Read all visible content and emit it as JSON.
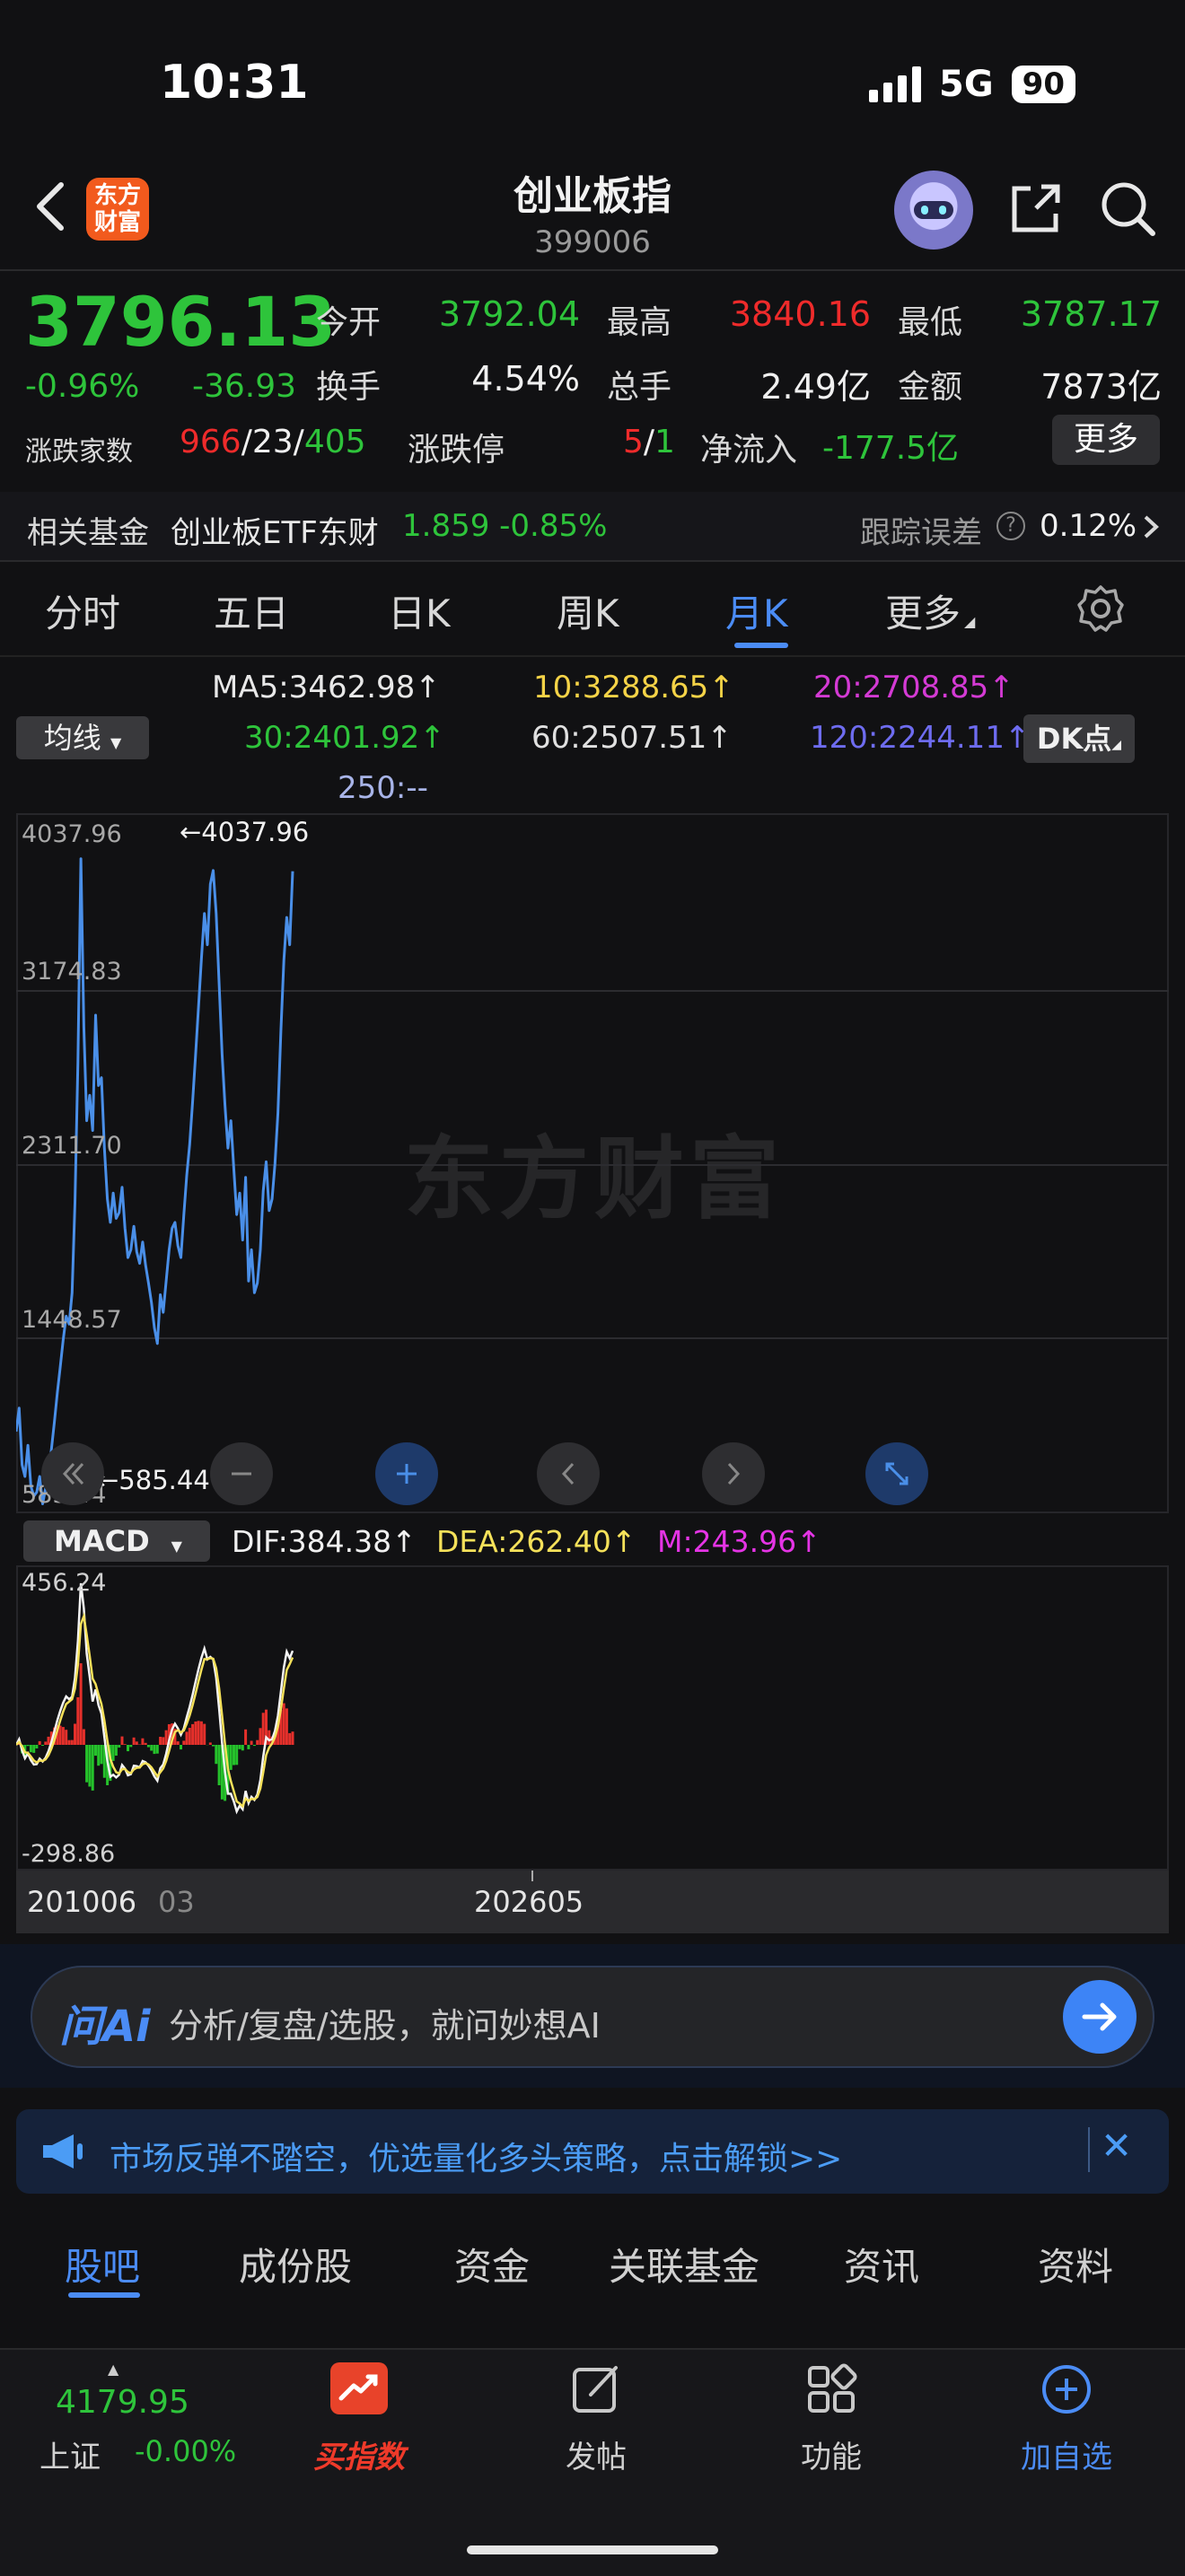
{
  "status": {
    "time": "10:31",
    "network": "5G",
    "battery": "90"
  },
  "header": {
    "title": "创业板指",
    "code": "399006",
    "logo_text": [
      "东方",
      "财富"
    ]
  },
  "quote": {
    "price": "3796.13",
    "change_pct": "-0.96%",
    "change_abs": "-36.93",
    "open_label": "今开",
    "open": "3792.04",
    "high_label": "最高",
    "high": "3840.16",
    "low_label": "最低",
    "low": "3787.17",
    "turnover_label": "换手",
    "turnover": "4.54%",
    "volume_label": "总手",
    "volume": "2.49亿",
    "amount_label": "金额",
    "amount": "7873亿",
    "updown_label": "涨跌家数",
    "up": "966",
    "flat": "23",
    "down": "405",
    "sep": "/",
    "limit_label": "涨跌停",
    "limit_up": "5",
    "limit_down": "1",
    "netflow_label": "净流入",
    "netflow": "-177.5亿",
    "more_label": "更多"
  },
  "fund": {
    "label": "相关基金",
    "name": "创业板ETF东财",
    "price": "1.859 -0.85%",
    "tracking_label": "跟踪误差",
    "tracking_value": "0.12%"
  },
  "tabs": [
    {
      "label": "分时",
      "active": false
    },
    {
      "label": "五日",
      "active": false
    },
    {
      "label": "日K",
      "active": false
    },
    {
      "label": "周K",
      "active": false
    },
    {
      "label": "月K",
      "active": true
    },
    {
      "label": "更多",
      "active": false
    }
  ],
  "ma": {
    "selector": "均线",
    "ma5": "MA5:3462.98↑",
    "ma10": "10:3288.65↑",
    "ma20": "20:2708.85↑",
    "ma30": "30:2401.92↑",
    "ma60": "60:2507.51↑",
    "ma120": "120:2244.11↑",
    "ma250": "250:--",
    "dk_button": "DK点",
    "colors": {
      "ma5": "#f0f0f0",
      "ma10": "#f5d347",
      "ma20": "#d43ad4",
      "ma30": "#2ec43b",
      "ma60": "#e0e0e0",
      "ma120": "#6e6cf0",
      "ma250": "#a8b4e8"
    }
  },
  "chart": {
    "y_ticks": [
      "4037.96",
      "3174.83",
      "2311.70",
      "1448.57",
      "585.44"
    ],
    "max_marker": "←4037.96",
    "min_marker": "←585.44",
    "watermark": "东方财富",
    "line_color": "#4a8fe8",
    "controls": [
      "chevrons-left-icon",
      "minus-icon",
      "plus-icon",
      "chevron-left-icon",
      "chevron-right-icon",
      "expand-icon"
    ]
  },
  "macd": {
    "selector": "MACD",
    "dif": "DIF:384.38↑",
    "dea": "DEA:262.40↑",
    "m": "M:243.96↑",
    "y_ticks": [
      "456.24",
      "-298.86"
    ]
  },
  "chart_data": {
    "type": "line",
    "title": "",
    "xlabel": "",
    "ylabel": "",
    "ylim": [
      585.44,
      4037.96
    ],
    "x_start": "201006",
    "x_end": "202605",
    "series": [
      {
        "values": [
          930,
          1050,
          760,
          700,
          860,
          650,
          600,
          620,
          700,
          560,
          640,
          720,
          840,
          980,
          1130,
          1260,
          1400,
          1520,
          1480,
          1640,
          2100,
          2820,
          3860,
          3000,
          2520,
          2650,
          2470,
          3060,
          2700,
          2740,
          2380,
          2120,
          2000,
          2150,
          2020,
          2050,
          2180,
          1970,
          1820,
          1860,
          1980,
          1850,
          1790,
          1900,
          1780,
          1690,
          1590,
          1460,
          1380,
          1630,
          1540,
          1700,
          1860,
          1970,
          2000,
          1880,
          1820,
          2040,
          2240,
          2400,
          2620,
          2860,
          3100,
          3350,
          3580,
          3420,
          3730,
          3800,
          3580,
          3220,
          2860,
          2600,
          2380,
          2520,
          2270,
          2040,
          2150,
          1910,
          2230,
          1700,
          1860,
          1640,
          1690,
          1860,
          2160,
          2310,
          2060,
          2120,
          2300,
          2560,
          2980,
          3340,
          3560,
          3420,
          3796
        ]
      }
    ]
  },
  "date_axis": [
    "201006",
    "03",
    "202605"
  ],
  "ai": {
    "logo": "问Ai",
    "placeholder": "分析/复盘/选股，就问妙想AI"
  },
  "ad": {
    "text": "市场反弹不踏空，优选量化多头策略，点击解锁>>"
  },
  "bottom_tabs": [
    {
      "label": "股吧",
      "active": true
    },
    {
      "label": "成份股",
      "active": false
    },
    {
      "label": "资金",
      "active": false
    },
    {
      "label": "关联基金",
      "active": false
    },
    {
      "label": "资讯",
      "active": false
    },
    {
      "label": "资料",
      "active": false
    }
  ],
  "nav": {
    "index_value": "4179.95",
    "index_name": "上证",
    "index_change": "-0.00%",
    "buy_label": "买指数",
    "post_label": "发帖",
    "func_label": "功能",
    "add_label": "加自选"
  }
}
